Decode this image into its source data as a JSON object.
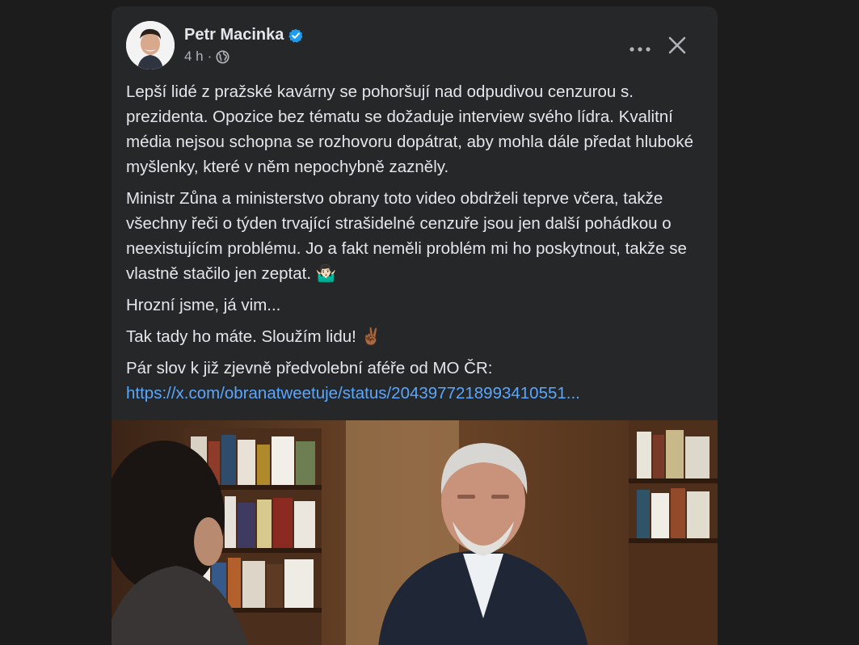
{
  "post": {
    "author": {
      "name": "Petr Macinka",
      "verified_icon": "verified-badge-icon"
    },
    "time": "4 h",
    "separator": "·",
    "privacy_icon": "globe-icon",
    "more_icon": "more-options-icon",
    "close_icon": "close-icon",
    "paragraphs": [
      "Lepší lidé z pražské kavárny se pohoršují nad odpudivou cenzurou s. prezidenta. Opozice bez tématu se dožaduje interview svého lídra. Kvalitní média nejsou schopna se rozhovoru dopátrat, aby mohla dále předat hluboké myšlenky, které v něm nepochybně zazněly.",
      "Ministr Zůna a ministerstvo obrany toto video obdrželi teprve včera, takže všechny řeči o týden trvající strašidelné cenzuře jsou jen další pohádkou o neexistujícím problému. Jo a fakt neměli problém mi ho poskytnout, takže se vlastně stačilo jen zeptat. 🤷🏻‍♂️",
      "Hrozní jsme, já vim...",
      "Tak tady ho máte. Sloužím lidu! ✌🏾",
      "Pár slov k již zjevně předvolební aféře od MO ČR:"
    ],
    "link": "https://x.com/obranatweetuje/status/2043977218993410551...",
    "colors": {
      "background": "#1c1c1d",
      "card": "#252728",
      "text": "#e4e6eb",
      "secondary": "#b0b3b8",
      "link": "#5aa7ff",
      "verified": "#1d9bf0"
    }
  }
}
